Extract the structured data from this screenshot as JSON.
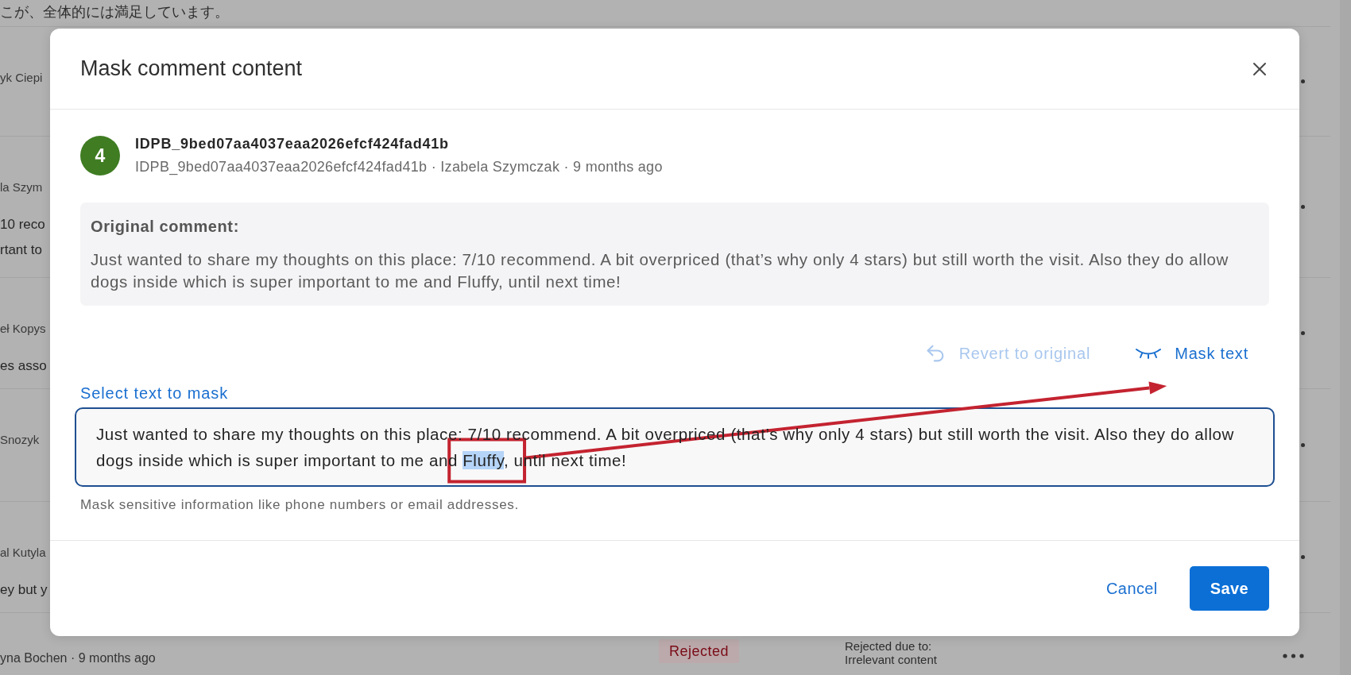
{
  "background": {
    "top_comment": "こが、全体的には満足しています。",
    "rows": [
      {
        "name": "yk Ciepi"
      },
      {
        "name": "la Szym",
        "comment_lines": [
          "10 reco",
          "rtant to"
        ]
      },
      {
        "name": "eł Kopys",
        "comment_lines": [
          "es asso"
        ]
      },
      {
        "name": "Snozyk"
      },
      {
        "name": "al Kutyla",
        "comment_lines": [
          "ey but y"
        ]
      }
    ],
    "last_row": {
      "author": "yna Bochen · 9 months ago",
      "status": "Rejected",
      "reason_label": "Rejected due to:",
      "reason": "Irrelevant content"
    }
  },
  "dialog": {
    "title": "Mask comment content",
    "response": {
      "score": "4",
      "title": "IDPB_9bed07aa4037eaa2026efcf424fad41b",
      "meta": "IDPB_9bed07aa4037eaa2026efcf424fad41b · Izabela Szymczak · 9 months ago"
    },
    "original_comment": {
      "heading": "Original comment:",
      "text": "Just wanted to share my thoughts on this place: 7/10 recommend. A bit overpriced (that’s why only 4 stars) but still worth the visit. Also they do allow dogs inside which is super important to me and Fluffy, until next time!"
    },
    "actions": [
      {
        "kind": "revert",
        "label": "Revert to original",
        "disabled": true
      },
      {
        "kind": "mask",
        "label": "Mask text",
        "disabled": false
      }
    ],
    "mask_field": {
      "label": "Select text to mask",
      "segments": [
        {
          "text": "Just wanted to share my thoughts on this place: 7/10 recommend. A bit overpriced (that’s why only 4 stars) but still worth the visit. Also they do allow dogs inside which is super important to me and ",
          "selected": false
        },
        {
          "text": "Fluffy",
          "selected": true
        },
        {
          "text": ", until next time!",
          "selected": false
        }
      ],
      "hint": "Mask sensitive information like phone numbers or email addresses."
    },
    "buttons": [
      {
        "kind": "secondary",
        "label": "Cancel"
      },
      {
        "kind": "primary",
        "label": "Save"
      }
    ],
    "annotation": {
      "kind": "frame_and_arrow"
    }
  }
}
